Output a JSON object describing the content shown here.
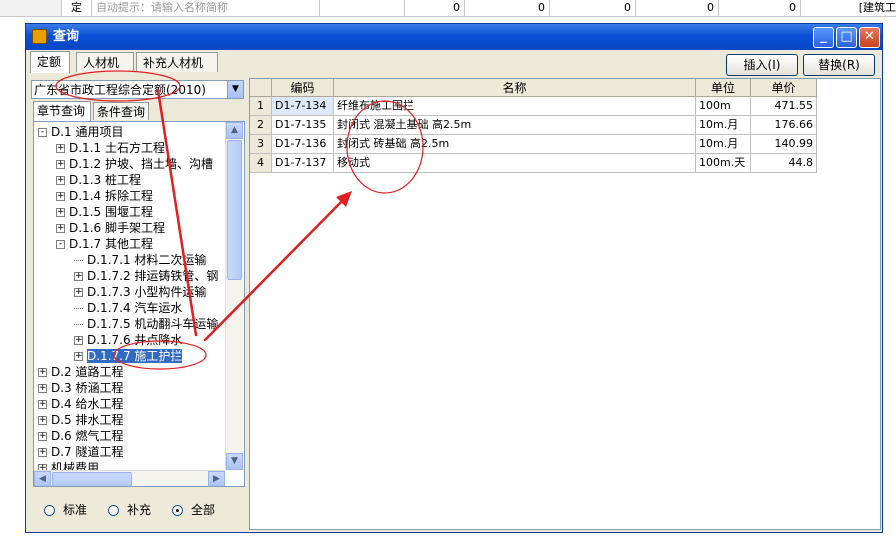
{
  "background_row": {
    "col1": "定",
    "col2": "自动提示：请输入名称简称",
    "zeros": [
      "0",
      "0",
      "0",
      "0",
      "0"
    ],
    "right": "[建筑工"
  },
  "window": {
    "title": "查询",
    "controls": {
      "minimize": "_",
      "maximize": "□",
      "close": "✕"
    }
  },
  "top_tabs": [
    "定额",
    "人材机",
    "补充人材机"
  ],
  "buttons": {
    "insert": "插入(I)",
    "replace": "替换(R)"
  },
  "dropdown": {
    "value": "广东省市政工程综合定额(2010)"
  },
  "sub_tabs": [
    "章节查询",
    "条件查询"
  ],
  "tree": [
    {
      "label": "D.1 通用项目",
      "level": 0,
      "expander": "-"
    },
    {
      "label": "D.1.1 土石方工程",
      "level": 1,
      "expander": "+"
    },
    {
      "label": "D.1.2 护坡、挡土墙、沟槽",
      "level": 1,
      "expander": "+"
    },
    {
      "label": "D.1.3 桩工程",
      "level": 1,
      "expander": "+"
    },
    {
      "label": "D.1.4  拆除工程",
      "level": 1,
      "expander": "+"
    },
    {
      "label": "D.1.5 围堰工程",
      "level": 1,
      "expander": "+"
    },
    {
      "label": "D.1.6 脚手架工程",
      "level": 1,
      "expander": "+"
    },
    {
      "label": "D.1.7 其他工程",
      "level": 1,
      "expander": "-"
    },
    {
      "label": "D.1.7.1 材料二次运输",
      "level": 2,
      "expander": ""
    },
    {
      "label": "D.1.7.2 排运铸铁管、钢",
      "level": 2,
      "expander": "+"
    },
    {
      "label": "D.1.7.3 小型构件运输",
      "level": 2,
      "expander": "+"
    },
    {
      "label": "D.1.7.4 汽车运水",
      "level": 2,
      "expander": ""
    },
    {
      "label": "D.1.7.5 机动翻斗车运输",
      "level": 2,
      "expander": ""
    },
    {
      "label": "D.1.7.6 井点降水",
      "level": 2,
      "expander": "+"
    },
    {
      "label": "D.1.7.7 施工护拦",
      "level": 2,
      "expander": "+",
      "selected": true
    },
    {
      "label": "D.2 道路工程",
      "level": 0,
      "expander": "+"
    },
    {
      "label": "D.3 桥涵工程",
      "level": 0,
      "expander": "+"
    },
    {
      "label": "D.4 给水工程",
      "level": 0,
      "expander": "+"
    },
    {
      "label": "D.5 排水工程",
      "level": 0,
      "expander": "+"
    },
    {
      "label": "D.6 燃气工程",
      "level": 0,
      "expander": "+"
    },
    {
      "label": "D.7 隧道工程",
      "level": 0,
      "expander": "+"
    },
    {
      "label": "机械费用",
      "level": 0,
      "expander": "+"
    }
  ],
  "radios": [
    {
      "label": "标准",
      "checked": false
    },
    {
      "label": "补充",
      "checked": false
    },
    {
      "label": "全部",
      "checked": true
    }
  ],
  "table": {
    "headers": [
      "编码",
      "名称",
      "单位",
      "单价"
    ],
    "rows": [
      {
        "n": "1",
        "code": "D1-7-134",
        "name": "纤维布施工围拦",
        "unit": "100m",
        "price": "471.55"
      },
      {
        "n": "2",
        "code": "D1-7-135",
        "name": "封闭式 混凝土基础 高2.5m",
        "unit": "10m.月",
        "price": "176.66"
      },
      {
        "n": "3",
        "code": "D1-7-136",
        "name": "封闭式 砖基础 高2.5m",
        "unit": "10m.月",
        "price": "140.99"
      },
      {
        "n": "4",
        "code": "D1-7-137",
        "name": "移动式",
        "unit": "100m.天",
        "price": "44.8"
      }
    ]
  },
  "colors": {
    "annotation": "#e02020",
    "titlebar": "#0a50d6",
    "selection": "#316ac5"
  }
}
